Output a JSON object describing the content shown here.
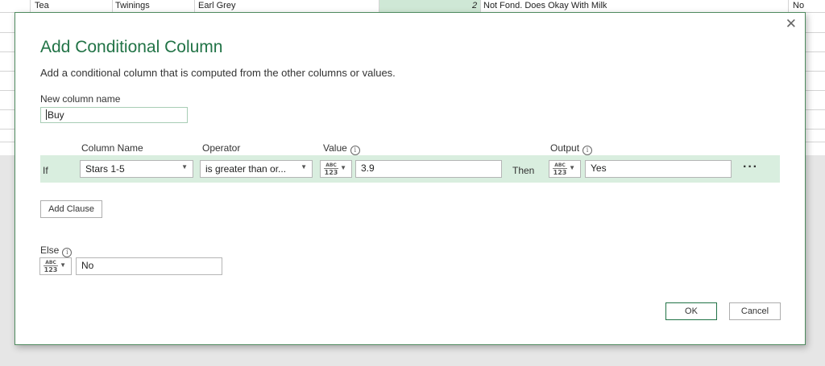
{
  "spreadsheet": {
    "row": [
      "Tea",
      "Twinings",
      "Earl Grey",
      "2",
      "Not Fond. Does Okay With Milk",
      "No"
    ]
  },
  "dialog": {
    "close_glyph": "✕",
    "title": "Add Conditional Column",
    "description": "Add a conditional column that is computed from the other columns or values.",
    "new_column_label": "New column name",
    "new_column_value": "Buy",
    "headers": {
      "column_name": "Column Name",
      "operator": "Operator",
      "value": "Value",
      "output": "Output"
    },
    "info_glyph": "i",
    "clause": {
      "if_label": "If",
      "column": "Stars 1-5",
      "operator": "is greater than or...",
      "value": "3.9",
      "then_label": "Then",
      "output": "Yes"
    },
    "type_icon": {
      "top": "ABC",
      "bottom": "123"
    },
    "dropdown_glyph": "▼",
    "more_glyph": "···",
    "add_clause_label": "Add Clause",
    "else_label": "Else",
    "else_value": "No",
    "ok_label": "OK",
    "cancel_label": "Cancel"
  }
}
